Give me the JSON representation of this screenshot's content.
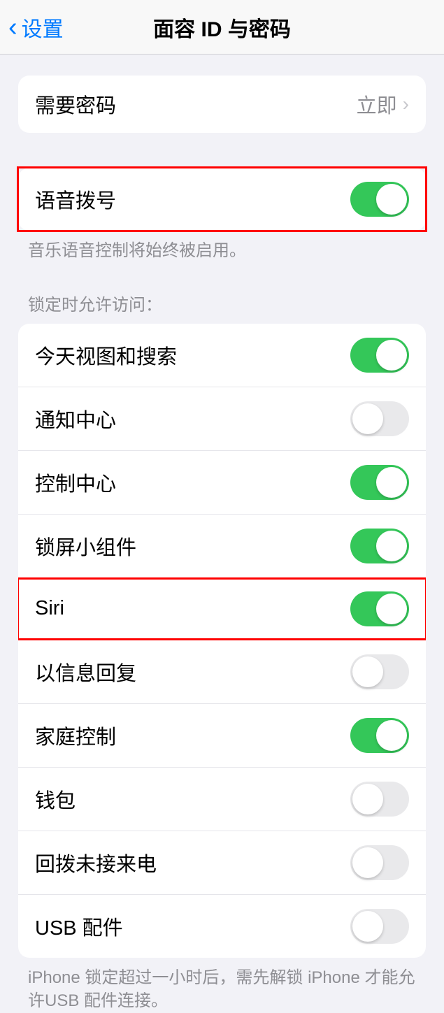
{
  "header": {
    "back_label": "设置",
    "title": "面容 ID 与密码"
  },
  "passcode": {
    "label": "需要密码",
    "value": "立即"
  },
  "voice_dial": {
    "label": "语音拨号",
    "on": true,
    "footer": "音乐语音控制将始终被启用。"
  },
  "lock_access": {
    "header": "锁定时允许访问：",
    "items": [
      {
        "label": "今天视图和搜索",
        "on": true
      },
      {
        "label": "通知中心",
        "on": false
      },
      {
        "label": "控制中心",
        "on": true
      },
      {
        "label": "锁屏小组件",
        "on": true
      },
      {
        "label": "Siri",
        "on": true
      },
      {
        "label": "以信息回复",
        "on": false
      },
      {
        "label": "家庭控制",
        "on": true
      },
      {
        "label": "钱包",
        "on": false
      },
      {
        "label": "回拨未接来电",
        "on": false
      },
      {
        "label": "USB 配件",
        "on": false
      }
    ],
    "footer": "iPhone 锁定超过一小时后，需先解锁 iPhone 才能允许USB 配件连接。"
  }
}
